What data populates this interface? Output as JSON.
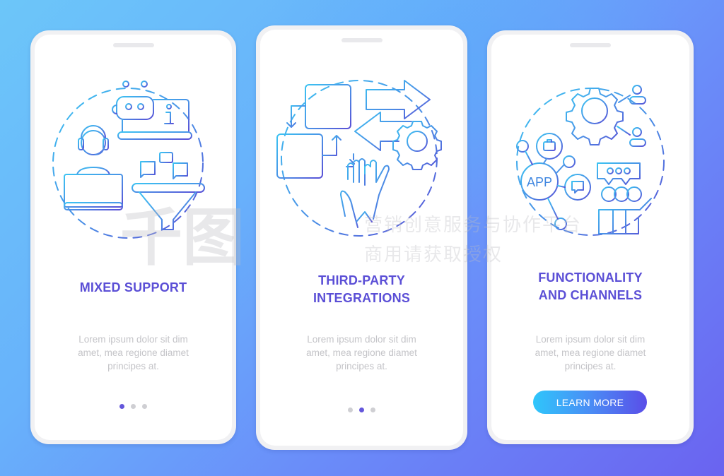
{
  "colors": {
    "title": "#5b4fd6",
    "description": "#c4c4c8",
    "dot_active": "#6457db",
    "dot_inactive": "#cfcfd3",
    "icon_gradient_start": "#38b8ee",
    "icon_gradient_end": "#5a52d8",
    "button_gradient": [
      "#2fc6fb",
      "#4a8df5",
      "#5a4ee8"
    ]
  },
  "screens": [
    {
      "title_lines": [
        "MIXED SUPPORT"
      ],
      "description_lines": [
        "Lorem ipsum dolor sit dim",
        "amet, mea regione diamet",
        "principes at."
      ],
      "illustration": "support-agent-chatbot-funnel-icon",
      "pager": {
        "count": 3,
        "active": 1
      }
    },
    {
      "title_lines": [
        "THIRD-PARTY",
        "INTEGRATIONS"
      ],
      "description_lines": [
        "Lorem ipsum dolor sit dim",
        "amet, mea regione diamet",
        "principes at."
      ],
      "illustration": "windows-arrows-gear-high-five-icon",
      "pager": {
        "count": 3,
        "active": 2
      }
    },
    {
      "title_lines": [
        "FUNCTIONALITY",
        "AND CHANNELS"
      ],
      "description_lines": [
        "Lorem ipsum dolor sit dim",
        "amet, mea regione diamet",
        "principes at."
      ],
      "illustration": "app-network-gear-team-icon",
      "button_label": "LEARN MORE"
    }
  ],
  "watermark": {
    "logo_text": "千图",
    "line1": "营销创意服务与协作平台",
    "line2": "商用请获取授权"
  }
}
